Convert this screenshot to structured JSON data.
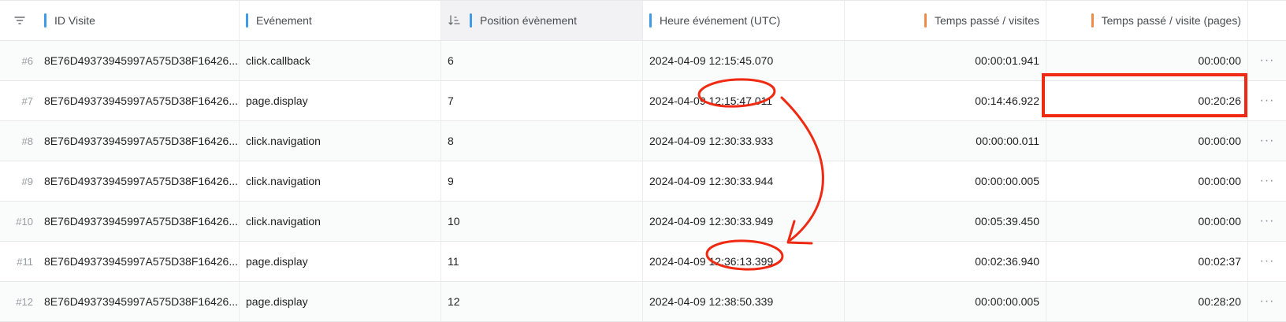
{
  "columns": {
    "id_visite": "ID Visite",
    "evenement": "Evénement",
    "position": "Position évènement",
    "heure": "Heure événement (UTC)",
    "temps_visites": "Temps passé / visites",
    "temps_pages": "Temps passé / visite (pages)"
  },
  "rows": [
    {
      "index": "#6",
      "id": "8E76D49373945997A575D38F16426...",
      "event": "click.callback",
      "position": "6",
      "time": "2024-04-09 12:15:45.070",
      "spent_visits": "00:00:01.941",
      "spent_pages": "00:00:00"
    },
    {
      "index": "#7",
      "id": "8E76D49373945997A575D38F16426...",
      "event": "page.display",
      "position": "7",
      "time": "2024-04-09 12:15:47.011",
      "spent_visits": "00:14:46.922",
      "spent_pages": "00:20:26"
    },
    {
      "index": "#8",
      "id": "8E76D49373945997A575D38F16426...",
      "event": "click.navigation",
      "position": "8",
      "time": "2024-04-09 12:30:33.933",
      "spent_visits": "00:00:00.011",
      "spent_pages": "00:00:00"
    },
    {
      "index": "#9",
      "id": "8E76D49373945997A575D38F16426...",
      "event": "click.navigation",
      "position": "9",
      "time": "2024-04-09 12:30:33.944",
      "spent_visits": "00:00:00.005",
      "spent_pages": "00:00:00"
    },
    {
      "index": "#10",
      "id": "8E76D49373945997A575D38F16426...",
      "event": "click.navigation",
      "position": "10",
      "time": "2024-04-09 12:30:33.949",
      "spent_visits": "00:05:39.450",
      "spent_pages": "00:00:00"
    },
    {
      "index": "#11",
      "id": "8E76D49373945997A575D38F16426...",
      "event": "page.display",
      "position": "11",
      "time": "2024-04-09 12:36:13.399",
      "spent_visits": "00:02:36.940",
      "spent_pages": "00:02:37"
    },
    {
      "index": "#12",
      "id": "8E76D49373945997A575D38F16426...",
      "event": "page.display",
      "position": "12",
      "time": "2024-04-09 12:38:50.339",
      "spent_visits": "00:00:00.005",
      "spent_pages": "00:28:20"
    }
  ],
  "row_menu_label": "···",
  "colors": {
    "dimension_bar": "#3d9be9",
    "metric_bar": "#f08a4b",
    "annotation": "#f02a12"
  },
  "icons": {
    "filter": "filter-icon",
    "sort": "sort-ascending-icon",
    "row_menu": "more-horizontal-icon"
  }
}
